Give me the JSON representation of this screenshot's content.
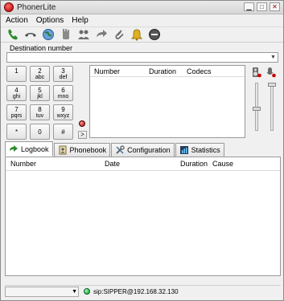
{
  "window": {
    "title": "PhonerLite"
  },
  "menu": [
    "Action",
    "Options",
    "Help"
  ],
  "toolbar": {
    "buttons": [
      "call-icon",
      "hangup-icon",
      "globe-icon",
      "hold-hand-icon",
      "conference-icon",
      "transfer-icon",
      "paperclip-icon",
      "bell-icon",
      "dnd-icon"
    ]
  },
  "destination": {
    "label": "Destination number",
    "value": "",
    "placeholder": ""
  },
  "keypad": [
    {
      "main": "1",
      "sub": ""
    },
    {
      "main": "2",
      "sub": "abc"
    },
    {
      "main": "3",
      "sub": "def"
    },
    {
      "main": "4",
      "sub": "ghi"
    },
    {
      "main": "5",
      "sub": "jkl"
    },
    {
      "main": "6",
      "sub": "mno"
    },
    {
      "main": "7",
      "sub": "pqrs"
    },
    {
      "main": "8",
      "sub": "tuv"
    },
    {
      "main": "9",
      "sub": "wxyz"
    },
    {
      "main": "*",
      "sub": ""
    },
    {
      "main": "0",
      "sub": ""
    },
    {
      "main": "#",
      "sub": ""
    }
  ],
  "go_button": ">",
  "calls": {
    "columns": [
      "Number",
      "Duration",
      "Codecs"
    ],
    "rows": []
  },
  "tabs": [
    {
      "label": "Logbook",
      "icon": "logbook-icon",
      "active": true
    },
    {
      "label": "Phonebook",
      "icon": "phonebook-icon",
      "active": false
    },
    {
      "label": "Configuration",
      "icon": "configuration-icon",
      "active": false
    },
    {
      "label": "Statistics",
      "icon": "statistics-icon",
      "active": false
    }
  ],
  "logbook": {
    "columns": [
      "Number",
      "Date",
      "Duration",
      "Cause"
    ],
    "rows": []
  },
  "status": {
    "registration": "sip:SIPPER@192.168.32.130",
    "profile": ""
  },
  "colors": {
    "led_red": "#c00000",
    "led_green": "#22aa22",
    "accent": "#3a6ea5"
  }
}
